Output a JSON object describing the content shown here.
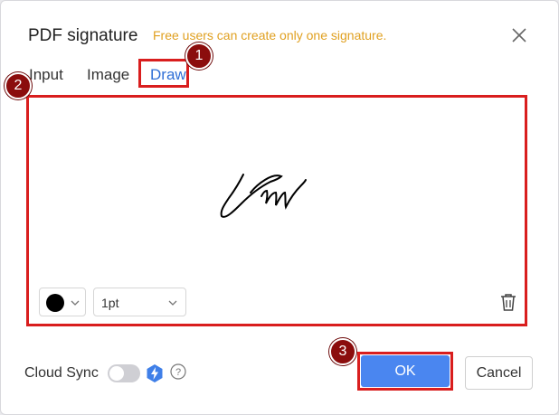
{
  "dialog": {
    "title": "PDF signature",
    "notice": "Free users can create only one signature.",
    "close_icon": "close-icon"
  },
  "tabs": [
    {
      "label": "Input",
      "active": false
    },
    {
      "label": "Image",
      "active": false
    },
    {
      "label": "Draw",
      "active": true
    }
  ],
  "toolbar": {
    "color_value": "#000000",
    "pen_size": "1pt",
    "delete_icon": "trash-icon"
  },
  "footer": {
    "cloud_sync_label": "Cloud Sync",
    "cloud_sync_enabled": false,
    "premium_icon": "lightning-badge-icon",
    "help_icon": "question-circle-icon",
    "ok_label": "OK",
    "cancel_label": "Cancel"
  },
  "annotations": [
    "1",
    "2",
    "3"
  ],
  "colors": {
    "accent": "#4a86f0",
    "notice": "#e0a020",
    "active_tab": "#2f6fd6",
    "highlight": "#d91e1e",
    "marker": "#8b0d0d"
  }
}
